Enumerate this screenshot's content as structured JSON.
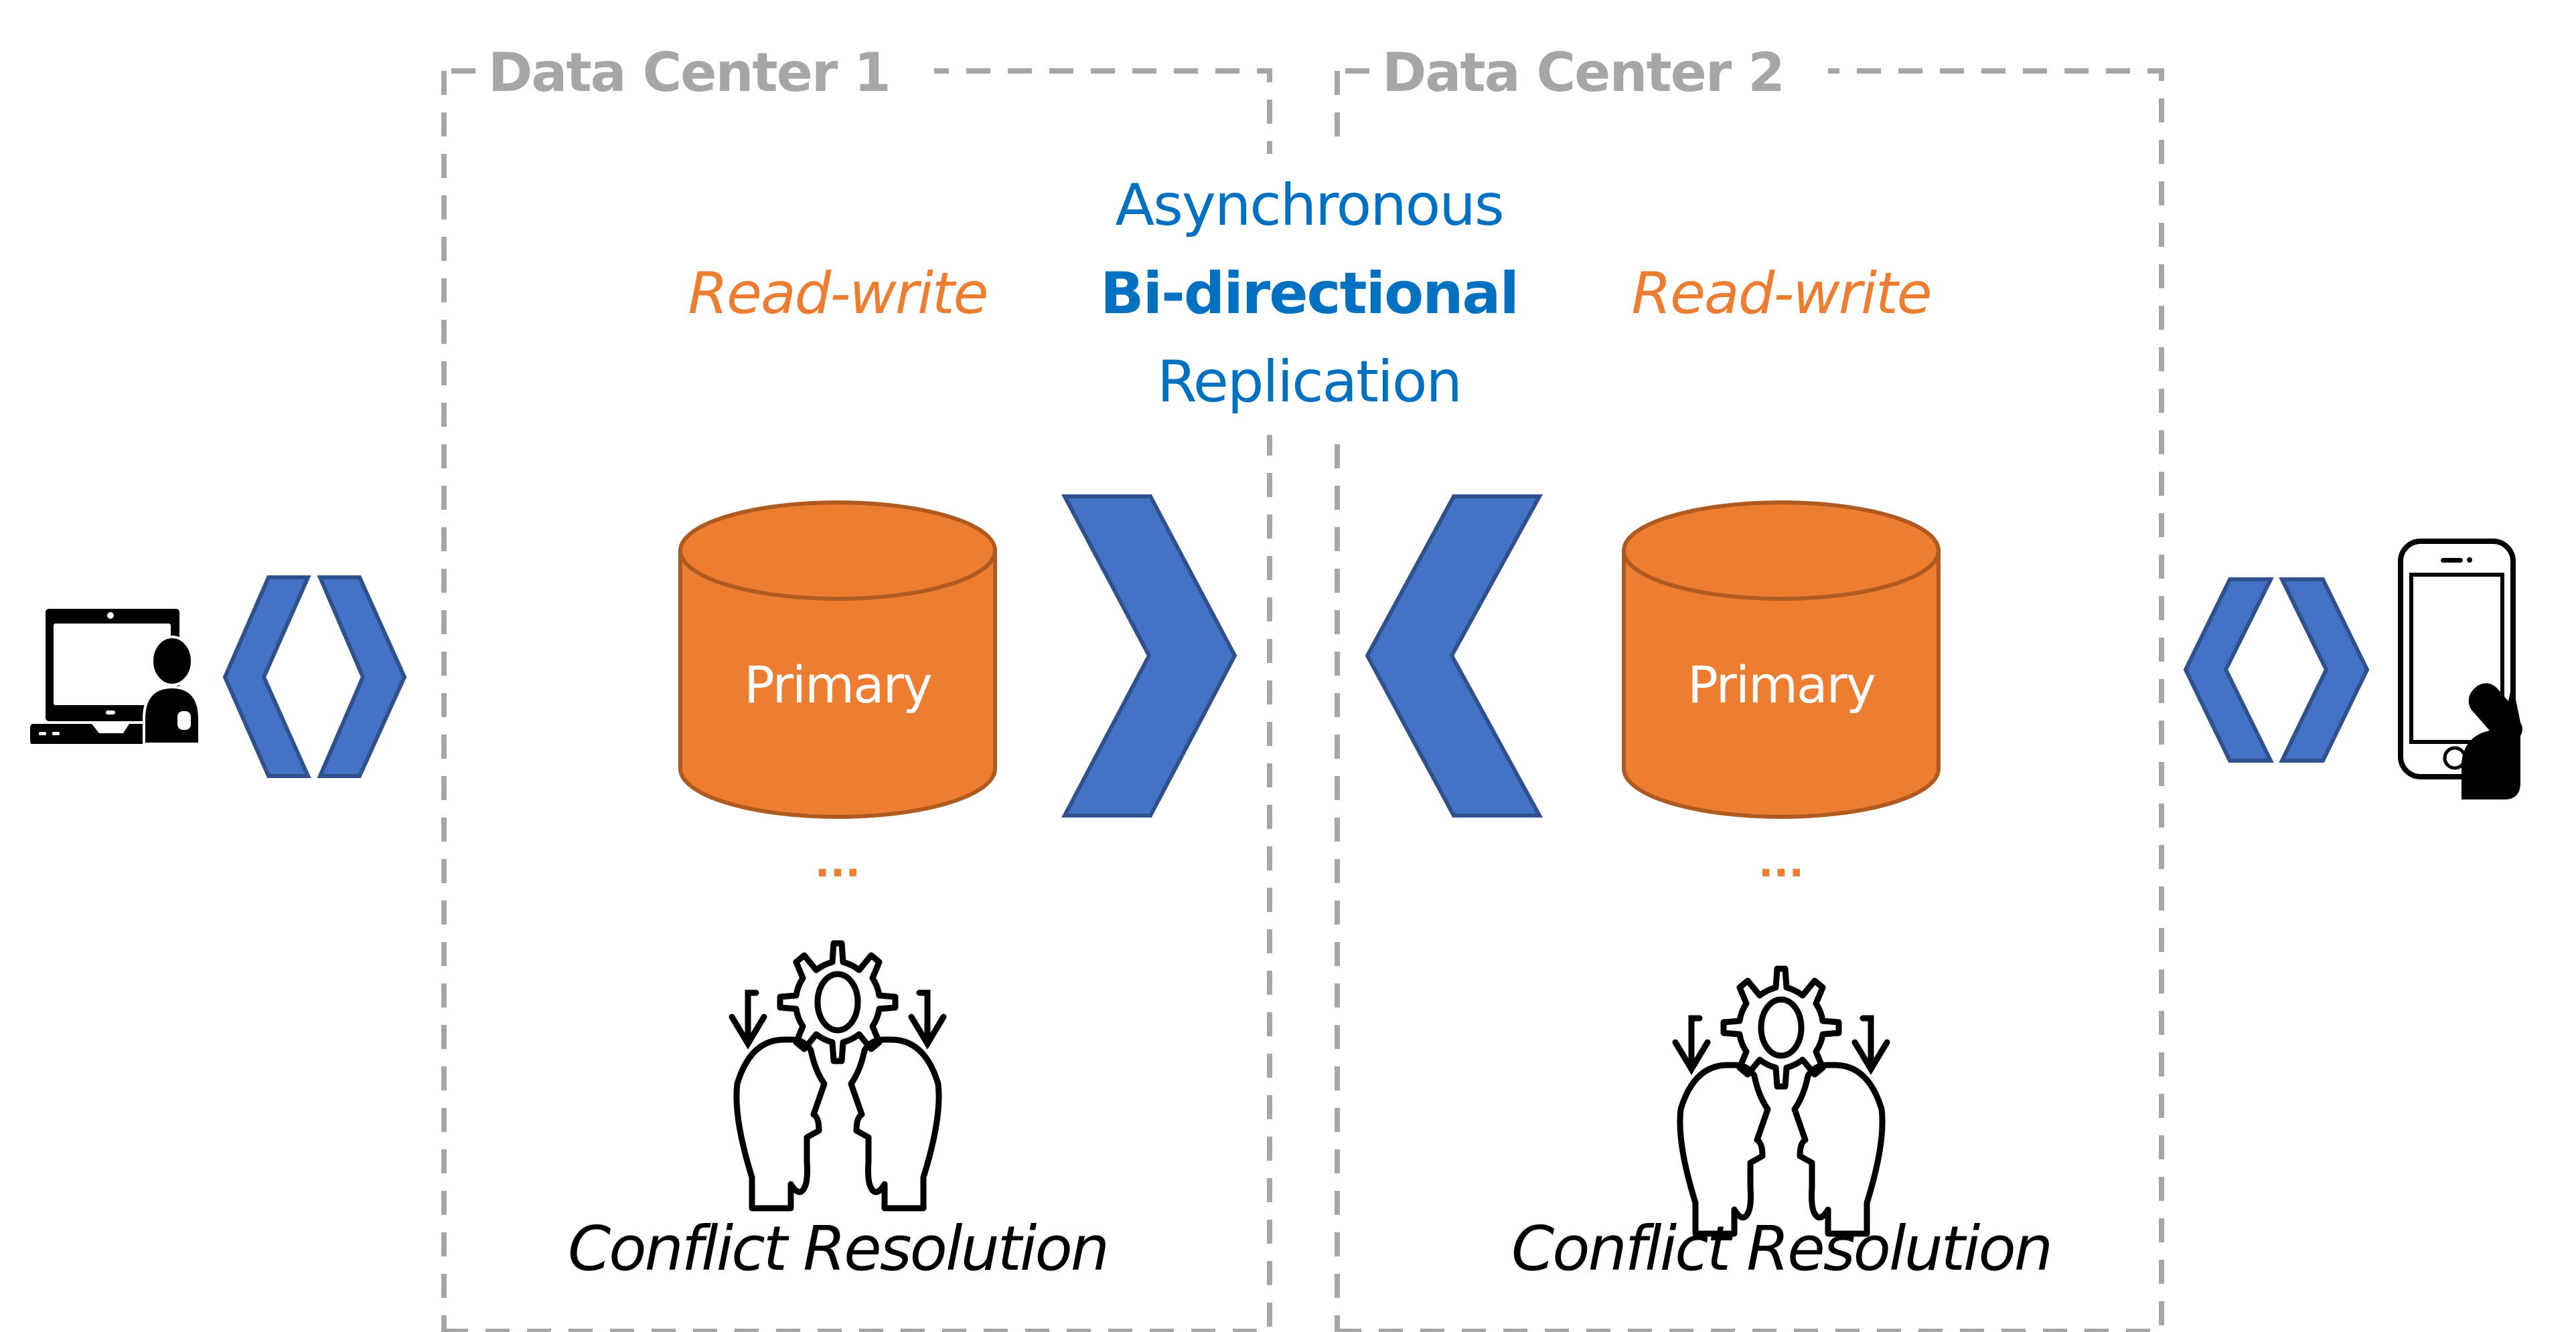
{
  "diagram": {
    "title": "Asynchronous Bi-directional Replication between two data centers",
    "colors": {
      "border_gray": "#A6A6A6",
      "replication_blue": "#0070C0",
      "chevron_fill": "#4472C4",
      "chevron_stroke": "#2F528F",
      "database_fill": "#ED7D31",
      "database_stroke": "#AE5A21",
      "readwrite_orange": "#ED7D31",
      "icon_black": "#000000"
    },
    "replication": {
      "line1": "Asynchronous",
      "line2": "Bi-directional",
      "line3": "Replication"
    },
    "data_centers": [
      {
        "label": "Data Center 1",
        "mode": "Read-write",
        "database": {
          "label": "Primary",
          "more": "..."
        },
        "conflict_label": "Conflict Resolution",
        "replication_arrow": "chevron-right"
      },
      {
        "label": "Data Center 2",
        "mode": "Read-write",
        "database": {
          "label": "Primary",
          "more": "..."
        },
        "conflict_label": "Conflict Resolution",
        "replication_arrow": "chevron-left"
      }
    ],
    "clients": [
      {
        "icon": "laptop-user-icon",
        "connector": "bidirectional-chevrons"
      },
      {
        "icon": "smartphone-hand-icon",
        "connector": "bidirectional-chevrons"
      }
    ]
  }
}
